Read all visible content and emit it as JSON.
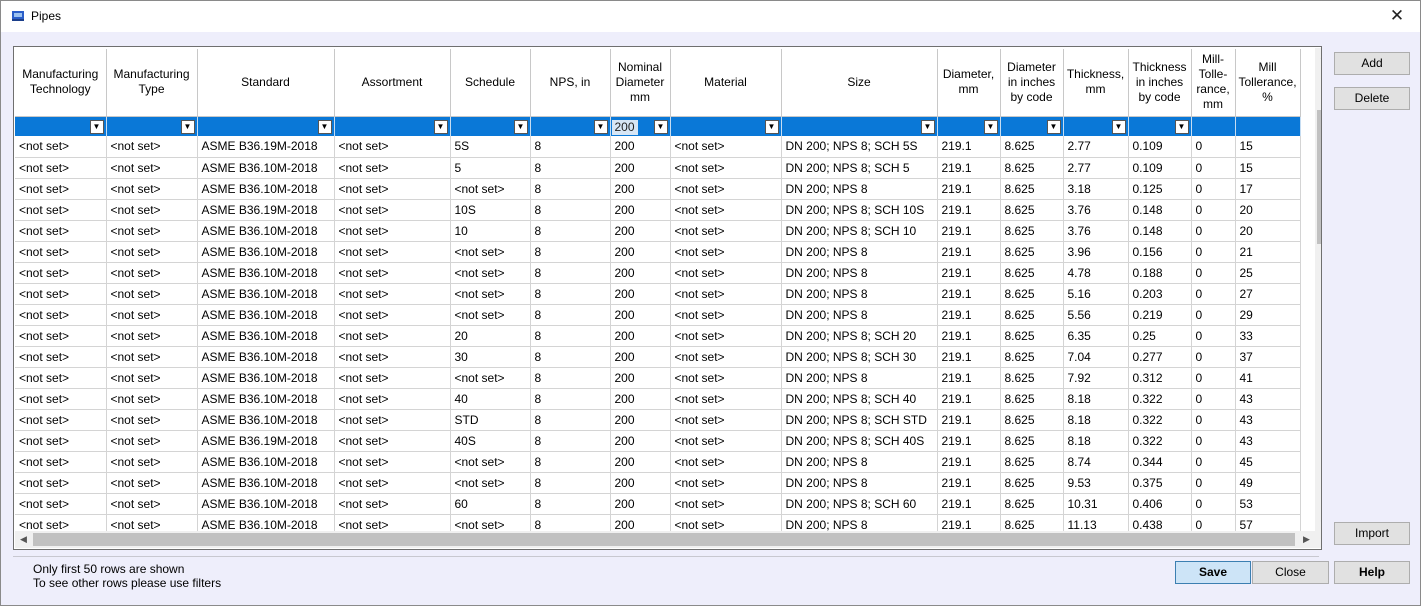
{
  "window": {
    "title": "Pipes",
    "close_glyph": "✕"
  },
  "grid": {
    "columns": [
      "Manufacturing Technology",
      "Manufacturing Type",
      "Standard",
      "Assortment",
      "Schedule",
      "NPS, in",
      "Nominal Diameter mm",
      "Material",
      "Size",
      "Diameter, mm",
      "Diameter in inches by code",
      "Thickness, mm",
      "Thickness in inches by code",
      "Mill-Tolle-rance, mm",
      "Mill Tollerance, %"
    ],
    "filters": [
      "",
      "",
      "",
      "",
      "",
      "",
      "200",
      "",
      "",
      "",
      "",
      "",
      "",
      "",
      ""
    ],
    "rows": [
      [
        "<not set>",
        "<not set>",
        "ASME B36.19M-2018",
        "<not set>",
        "5S",
        "8",
        "200",
        "<not set>",
        "DN 200; NPS 8; SCH 5S",
        "219.1",
        "8.625",
        "2.77",
        "0.109",
        "0",
        "15"
      ],
      [
        "<not set>",
        "<not set>",
        "ASME B36.10M-2018",
        "<not set>",
        "5",
        "8",
        "200",
        "<not set>",
        "DN 200; NPS 8; SCH 5",
        "219.1",
        "8.625",
        "2.77",
        "0.109",
        "0",
        "15"
      ],
      [
        "<not set>",
        "<not set>",
        "ASME B36.10M-2018",
        "<not set>",
        "<not set>",
        "8",
        "200",
        "<not set>",
        "DN 200; NPS 8",
        "219.1",
        "8.625",
        "3.18",
        "0.125",
        "0",
        "17"
      ],
      [
        "<not set>",
        "<not set>",
        "ASME B36.19M-2018",
        "<not set>",
        "10S",
        "8",
        "200",
        "<not set>",
        "DN 200; NPS 8; SCH 10S",
        "219.1",
        "8.625",
        "3.76",
        "0.148",
        "0",
        "20"
      ],
      [
        "<not set>",
        "<not set>",
        "ASME B36.10M-2018",
        "<not set>",
        "10",
        "8",
        "200",
        "<not set>",
        "DN 200; NPS 8; SCH 10",
        "219.1",
        "8.625",
        "3.76",
        "0.148",
        "0",
        "20"
      ],
      [
        "<not set>",
        "<not set>",
        "ASME B36.10M-2018",
        "<not set>",
        "<not set>",
        "8",
        "200",
        "<not set>",
        "DN 200; NPS 8",
        "219.1",
        "8.625",
        "3.96",
        "0.156",
        "0",
        "21"
      ],
      [
        "<not set>",
        "<not set>",
        "ASME B36.10M-2018",
        "<not set>",
        "<not set>",
        "8",
        "200",
        "<not set>",
        "DN 200; NPS 8",
        "219.1",
        "8.625",
        "4.78",
        "0.188",
        "0",
        "25"
      ],
      [
        "<not set>",
        "<not set>",
        "ASME B36.10M-2018",
        "<not set>",
        "<not set>",
        "8",
        "200",
        "<not set>",
        "DN 200; NPS 8",
        "219.1",
        "8.625",
        "5.16",
        "0.203",
        "0",
        "27"
      ],
      [
        "<not set>",
        "<not set>",
        "ASME B36.10M-2018",
        "<not set>",
        "<not set>",
        "8",
        "200",
        "<not set>",
        "DN 200; NPS 8",
        "219.1",
        "8.625",
        "5.56",
        "0.219",
        "0",
        "29"
      ],
      [
        "<not set>",
        "<not set>",
        "ASME B36.10M-2018",
        "<not set>",
        "20",
        "8",
        "200",
        "<not set>",
        "DN 200; NPS 8; SCH 20",
        "219.1",
        "8.625",
        "6.35",
        "0.25",
        "0",
        "33"
      ],
      [
        "<not set>",
        "<not set>",
        "ASME B36.10M-2018",
        "<not set>",
        "30",
        "8",
        "200",
        "<not set>",
        "DN 200; NPS 8; SCH 30",
        "219.1",
        "8.625",
        "7.04",
        "0.277",
        "0",
        "37"
      ],
      [
        "<not set>",
        "<not set>",
        "ASME B36.10M-2018",
        "<not set>",
        "<not set>",
        "8",
        "200",
        "<not set>",
        "DN 200; NPS 8",
        "219.1",
        "8.625",
        "7.92",
        "0.312",
        "0",
        "41"
      ],
      [
        "<not set>",
        "<not set>",
        "ASME B36.10M-2018",
        "<not set>",
        "40",
        "8",
        "200",
        "<not set>",
        "DN 200; NPS 8; SCH 40",
        "219.1",
        "8.625",
        "8.18",
        "0.322",
        "0",
        "43"
      ],
      [
        "<not set>",
        "<not set>",
        "ASME B36.10M-2018",
        "<not set>",
        "STD",
        "8",
        "200",
        "<not set>",
        "DN 200; NPS 8; SCH STD",
        "219.1",
        "8.625",
        "8.18",
        "0.322",
        "0",
        "43"
      ],
      [
        "<not set>",
        "<not set>",
        "ASME B36.19M-2018",
        "<not set>",
        "40S",
        "8",
        "200",
        "<not set>",
        "DN 200; NPS 8; SCH 40S",
        "219.1",
        "8.625",
        "8.18",
        "0.322",
        "0",
        "43"
      ],
      [
        "<not set>",
        "<not set>",
        "ASME B36.10M-2018",
        "<not set>",
        "<not set>",
        "8",
        "200",
        "<not set>",
        "DN 200; NPS 8",
        "219.1",
        "8.625",
        "8.74",
        "0.344",
        "0",
        "45"
      ],
      [
        "<not set>",
        "<not set>",
        "ASME B36.10M-2018",
        "<not set>",
        "<not set>",
        "8",
        "200",
        "<not set>",
        "DN 200; NPS 8",
        "219.1",
        "8.625",
        "9.53",
        "0.375",
        "0",
        "49"
      ],
      [
        "<not set>",
        "<not set>",
        "ASME B36.10M-2018",
        "<not set>",
        "60",
        "8",
        "200",
        "<not set>",
        "DN 200; NPS 8; SCH 60",
        "219.1",
        "8.625",
        "10.31",
        "0.406",
        "0",
        "53"
      ],
      [
        "<not set>",
        "<not set>",
        "ASME B36.10M-2018",
        "<not set>",
        "<not set>",
        "8",
        "200",
        "<not set>",
        "DN 200; NPS 8",
        "219.1",
        "8.625",
        "11.13",
        "0.438",
        "0",
        "57"
      ]
    ]
  },
  "buttons": {
    "add": "Add",
    "delete": "Delete",
    "import": "Import",
    "save": "Save",
    "close": "Close",
    "help": "Help"
  },
  "footer": {
    "line1": "Only first 50 rows are shown",
    "line2": "To see other rows please use filters"
  },
  "icons": {
    "dropdown": "▼",
    "scroll_up": "▲",
    "scroll_down": "▼",
    "scroll_left": "◀",
    "scroll_right": "▶"
  },
  "colors": {
    "filter_row": "#0a78d7",
    "primary_button": "#cde4f7"
  }
}
